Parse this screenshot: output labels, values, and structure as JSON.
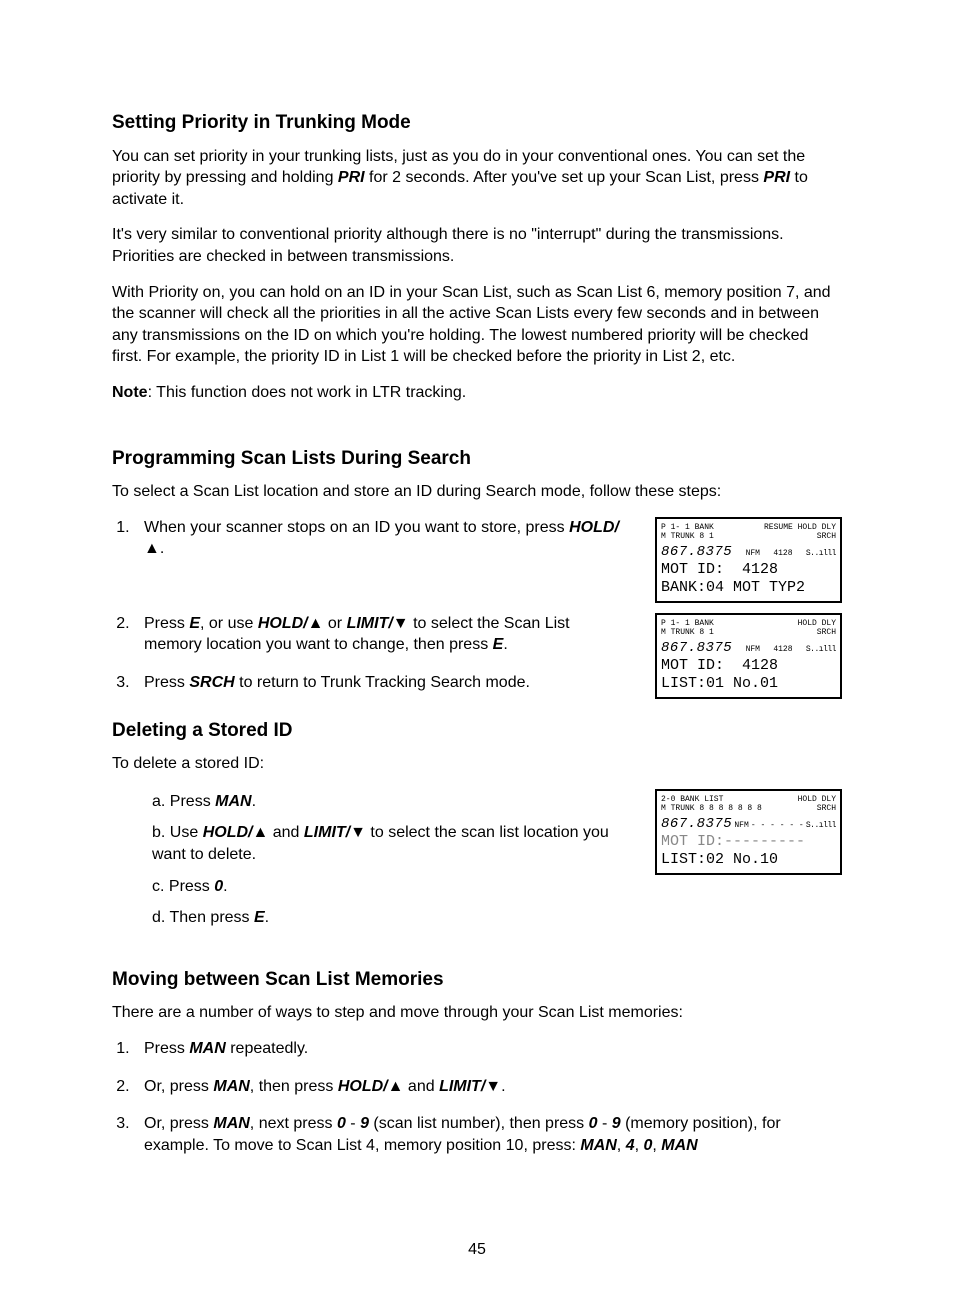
{
  "page_number": "45",
  "s1": {
    "heading": "Setting Priority in Trunking Mode",
    "p1a": "You can set priority in your trunking lists, just as you do in your conventional ones. You can set the priority by pressing and holding ",
    "pri1": "PRI",
    "p1b": " for 2 seconds. After you've set up your Scan List, press ",
    "pri2": "PRI",
    "p1c": " to activate it.",
    "p2": "It's very similar to conventional priority although there is no \"interrupt\" during the transmissions. Priorities are checked in between transmissions.",
    "p3": "With Priority on, you can hold on an ID in your Scan List, such as Scan List 6, memory position 7, and the scanner will check all the priorities in all the active Scan Lists every few seconds and in between any transmissions on the ID on which you're holding. The lowest numbered priority will be checked first. For example, the priority ID in List 1 will be checked before the priority in List 2, etc.",
    "note_label": "Note",
    "note_text": ":  This function does not work in LTR tracking."
  },
  "s2": {
    "heading": "Programming Scan Lists During Search",
    "intro": "To select a Scan List location and store an ID during Search mode, follow these steps:",
    "step1a": "When your scanner stops on an ID you want to store, press ",
    "hold1": "HOLD/",
    "step1b": ".",
    "step2a": "Press ",
    "e1": "E",
    "step2b": ", or use ",
    "hold2": "HOLD/",
    "step2c": " or ",
    "limit1": "LIMIT/",
    "step2d": " to select the Scan List memory location you want to change, then press ",
    "e2": "E",
    "step2e": ".",
    "step3a": "Press ",
    "srch": "SRCH",
    "step3b": " to return to Trunk Tracking Search mode."
  },
  "s3": {
    "heading": "Deleting a Stored ID",
    "intro": "To delete a stored ID:",
    "a_pre": "a. Press ",
    "man": "MAN",
    "a_post": ".",
    "b_pre": "b. Use ",
    "hold": "HOLD/",
    "b_mid": " and ",
    "limit": "LIMIT/",
    "b_post": " to select the scan list location you want to delete.",
    "c_pre": "c. Press ",
    "zero": "0",
    "c_post": ".",
    "d_pre": "d. Then press ",
    "e": "E",
    "d_post": "."
  },
  "s4": {
    "heading": "Moving between Scan List Memories",
    "intro": "There are a number of ways to step and move through your Scan List memories:",
    "step1a": "Press ",
    "man1": "MAN",
    "step1b": " repeatedly.",
    "step2a": "Or, press ",
    "man2": "MAN",
    "step2b": ", then press ",
    "hold": "HOLD/",
    "step2c": " and ",
    "limit": "LIMIT/",
    "step2d": ".",
    "step3a": "Or, press ",
    "man3": "MAN",
    "step3b": ", next press ",
    "n0a": "0",
    "step3c": " - ",
    "n9a": "9",
    "step3d": " (scan list number), then press ",
    "n0b": "0",
    "step3e": " - ",
    "n9b": "9",
    "step3f": " (memory position), for example. To move to Scan List 4, memory position 10, press: ",
    "man4": "MAN",
    "c1": ", ",
    "n4": "4",
    "c2": ", ",
    "n0c": "0",
    "c3": ", ",
    "man5": "MAN"
  },
  "lcd1": {
    "top_left_line1": "P  1- 1  BANK",
    "top_left_line2": "M  TRUNK 8 1",
    "top_right_line1": "RESUME  HOLD    DLY",
    "top_right_line2": "SRCH",
    "freq": "867.8375",
    "wfm": "NFM",
    "num": "4128",
    "sig": "S..ılll",
    "big1": "MOT ID:  4128",
    "big2": "BANK:04 MOT TYP2"
  },
  "lcd2": {
    "top_left_line1": "P  1- 1  BANK",
    "top_left_line2": "M  TRUNK 8 1",
    "top_right_line1": "HOLD    DLY",
    "top_right_line2": "SRCH",
    "freq": "867.8375",
    "wfm": "NFM",
    "num": "4128",
    "sig": "S..ılll",
    "big1": "MOT ID:  4128",
    "big2": "LIST:01 No.01"
  },
  "lcd3": {
    "top_left_line1": "2-0 BANK  LIST",
    "top_left_line2": "M  TRUNK 8 8 8 8 8 8 8",
    "top_right_line1": "HOLD    DLY",
    "top_right_line2": "SRCH",
    "freq": "867.8375",
    "wfm": "NFM",
    "num": "- - - - - -",
    "sig": "S..ılll",
    "big1": "MOT ID:---------",
    "big2": "LIST:02 No.10"
  }
}
